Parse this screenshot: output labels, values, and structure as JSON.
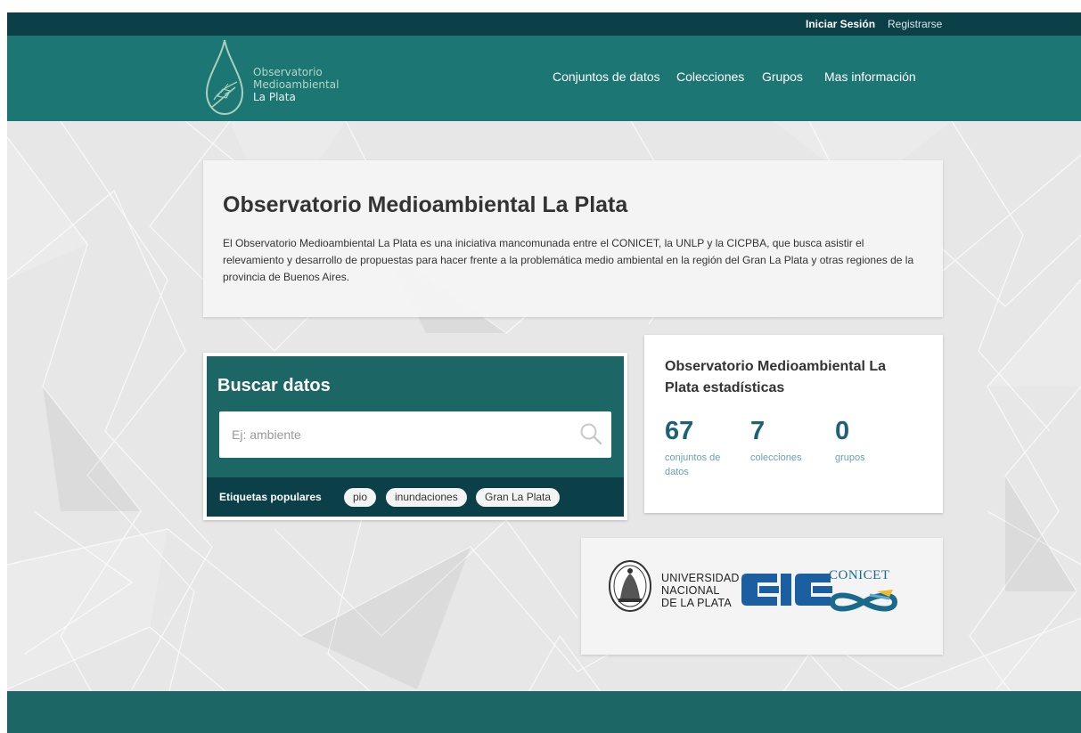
{
  "account": {
    "login_label": "Iniciar Sesión",
    "register_label": "Registrarse"
  },
  "site": {
    "logo_line1": "Observatorio",
    "logo_line2": "Medioambiental",
    "logo_line3": "La Plata"
  },
  "nav": {
    "datasets": "Conjuntos de datos",
    "collections": "Colecciones",
    "groups": "Grupos",
    "more_info": "Mas información"
  },
  "hero": {
    "title": "Observatorio Medioambiental La Plata",
    "description": "El Observatorio Medioambiental La Plata es una iniciativa mancomunada entre el CONICET, la UNLP y la CICPBA, que busca asistir el relevamiento y desarrollo de propuestas para hacer frente a la problemática medio ambiental en la región del Gran La Plata y otras regiones de la provincia de Buenos Aires."
  },
  "search": {
    "title": "Buscar datos",
    "placeholder": "Ej: ambiente",
    "popular_tags_label": "Etiquetas populares",
    "tags": [
      "pio",
      "inundaciones",
      "Gran La Plata"
    ]
  },
  "stats": {
    "title": "Observatorio Medioambiental La Plata estadísticas",
    "items": [
      {
        "value": "67",
        "label": "conjuntos de datos"
      },
      {
        "value": "7",
        "label": "colecciones"
      },
      {
        "value": "0",
        "label": "grupos"
      }
    ]
  },
  "partners": {
    "unlp_line1": "UNIVERSIDAD",
    "unlp_line2": "NACIONAL",
    "unlp_line3": "DE LA PLATA",
    "conicet_label": "CONICET"
  },
  "colors": {
    "account_bar": "#0b4049",
    "masthead": "#1c7673",
    "search_panel": "#1c6766",
    "stat_number": "#1d6178"
  }
}
